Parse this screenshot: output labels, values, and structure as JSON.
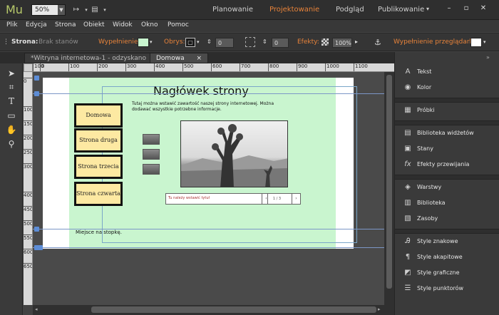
{
  "app": {
    "logo": "Mu"
  },
  "topbar": {
    "zoom": "50%",
    "modes": [
      "Planowanie",
      "Projektowanie",
      "Podgląd",
      "Publikowanie"
    ],
    "active_mode": "Projektowanie",
    "publish_arrow": "▾"
  },
  "menu": [
    "Plik",
    "Edycja",
    "Strona",
    "Obiekt",
    "Widok",
    "Okno",
    "Pomoc"
  ],
  "control": {
    "page_label": "Strona:",
    "page_value": "Brak stanów",
    "fill_label": "Wypełnienie:",
    "stroke_label": "Obrys:",
    "stroke_value": "0",
    "corner_value": "0",
    "effects_label": "Efekty:",
    "opacity": "100%",
    "browser_fill_label": "Wypełnienie przeglądarki:"
  },
  "tabs": [
    {
      "label": "*Witryna internetowa-1 - odzyskano",
      "close": "×"
    },
    {
      "label": "Domowa",
      "close": "×"
    }
  ],
  "ruler": {
    "h": [
      "100",
      "0",
      "100",
      "200",
      "300",
      "400",
      "500",
      "600",
      "700",
      "800",
      "900",
      "1000",
      "1100"
    ],
    "v": [
      "0",
      "100",
      "150",
      "200",
      "250",
      "300",
      "400",
      "450",
      "500",
      "550",
      "600",
      "650"
    ]
  },
  "page": {
    "title": "Nagłówek strony",
    "intro": "Tutaj można wstawić zawartość naszej strony internetowej. Można dodawać wszystkie potrzebne informacje.",
    "nav": [
      "Domowa",
      "Strona druga",
      "Strona trzecia",
      "Strona czwarta"
    ],
    "slider_caption": "Tu należy wstawić tytuł",
    "slider_prev": "‹",
    "slider_next": "›",
    "slider_counter": "1 / 3",
    "footer": "Miejsce na stopkę."
  },
  "panels": [
    {
      "icon": "text-icon",
      "label": "Tekst"
    },
    {
      "icon": "color-icon",
      "label": "Kolor"
    },
    {
      "icon": "swatches-icon",
      "label": "Próbki"
    },
    {
      "icon": "widgets-icon",
      "label": "Biblioteka widżetów"
    },
    {
      "icon": "states-icon",
      "label": "Stany"
    },
    {
      "icon": "transition-icon",
      "label": "Efekty przewijania"
    },
    {
      "icon": "layers-icon",
      "label": "Warstwy"
    },
    {
      "icon": "library-icon",
      "label": "Biblioteka"
    },
    {
      "icon": "assets-icon",
      "label": "Zasoby"
    },
    {
      "icon": "char-styles-icon",
      "label": "Style znakowe"
    },
    {
      "icon": "para-styles-icon",
      "label": "Style akapitowe"
    },
    {
      "icon": "graphic-styles-icon",
      "label": "Style graficzne"
    },
    {
      "icon": "bullet-styles-icon",
      "label": "Style punktorów"
    }
  ],
  "colors": {
    "accent": "#e8833a",
    "page_bg": "#c9f5cf",
    "nav_bg": "#fde9a2"
  }
}
